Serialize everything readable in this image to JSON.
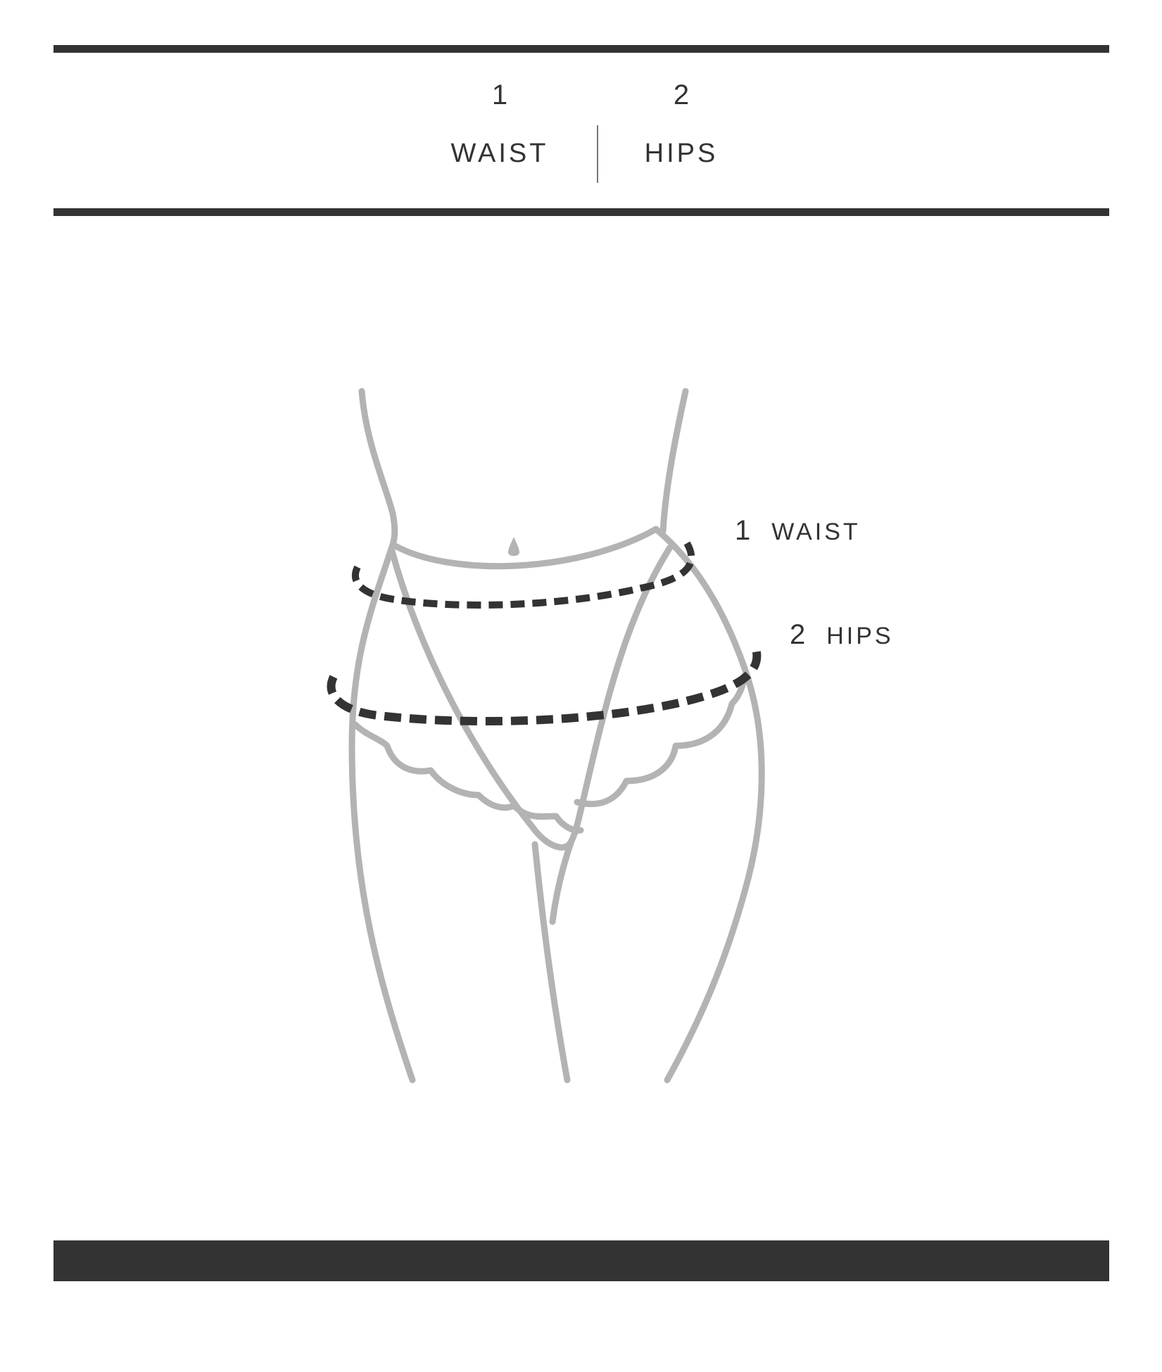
{
  "header": {
    "columns": [
      {
        "number": "1",
        "label": "WAIST"
      },
      {
        "number": "2",
        "label": "HIPS"
      }
    ]
  },
  "diagram": {
    "callouts": [
      {
        "number": "1",
        "label": "WAIST"
      },
      {
        "number": "2",
        "label": "HIPS"
      }
    ],
    "colors": {
      "rule": "#333333",
      "body_outline": "#b3b3b3",
      "measure_line": "#333333"
    }
  }
}
